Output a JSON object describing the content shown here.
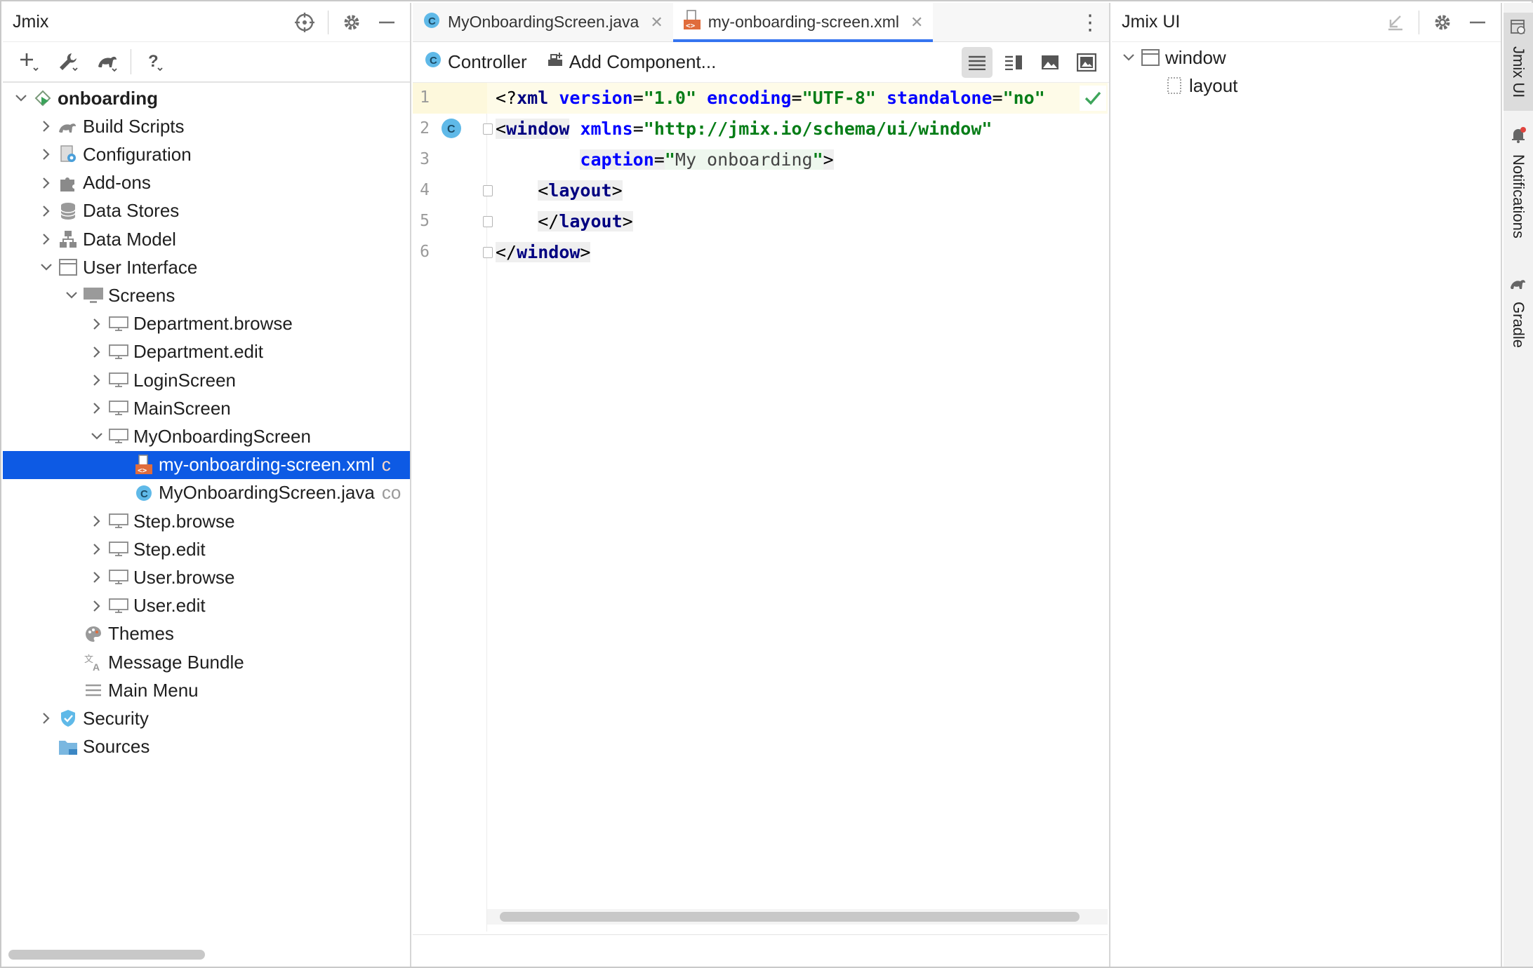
{
  "left_panel": {
    "title": "Jmix",
    "tree": [
      {
        "label": "onboarding",
        "bold": true,
        "icon": "project-icon",
        "expanded": true,
        "suffix": ""
      },
      {
        "label": "Build Scripts",
        "icon": "gradle-icon",
        "expanded": false,
        "suffix": ""
      },
      {
        "label": "Configuration",
        "icon": "configuration-icon",
        "expanded": false,
        "suffix": ""
      },
      {
        "label": "Add-ons",
        "icon": "puzzle-icon",
        "expanded": false,
        "suffix": ""
      },
      {
        "label": "Data Stores",
        "icon": "database-icon",
        "expanded": false,
        "suffix": ""
      },
      {
        "label": "Data Model",
        "icon": "data-model-icon",
        "expanded": false,
        "suffix": ""
      },
      {
        "label": "User Interface",
        "icon": "window-icon",
        "expanded": true,
        "suffix": ""
      },
      {
        "label": "Screens",
        "icon": "monitor-icon",
        "expanded": true,
        "suffix": ""
      },
      {
        "label": "Department.browse",
        "icon": "screen-icon",
        "expanded": false,
        "suffix": ""
      },
      {
        "label": "Department.edit",
        "icon": "screen-icon",
        "expanded": false,
        "suffix": ""
      },
      {
        "label": "LoginScreen",
        "icon": "screen-icon",
        "expanded": false,
        "suffix": ""
      },
      {
        "label": "MainScreen",
        "icon": "screen-icon",
        "expanded": false,
        "suffix": ""
      },
      {
        "label": "MyOnboardingScreen",
        "icon": "screen-icon",
        "expanded": true,
        "suffix": ""
      },
      {
        "label": "my-onboarding-screen.xml",
        "icon": "xml-file-icon",
        "selected": true,
        "suffix": "c"
      },
      {
        "label": "MyOnboardingScreen.java",
        "icon": "java-class-icon",
        "suffix": "co"
      },
      {
        "label": "Step.browse",
        "icon": "screen-icon",
        "expanded": false,
        "suffix": ""
      },
      {
        "label": "Step.edit",
        "icon": "screen-icon",
        "expanded": false,
        "suffix": ""
      },
      {
        "label": "User.browse",
        "icon": "screen-icon",
        "expanded": false,
        "suffix": ""
      },
      {
        "label": "User.edit",
        "icon": "screen-icon",
        "expanded": false,
        "suffix": ""
      },
      {
        "label": "Themes",
        "icon": "palette-icon",
        "suffix": ""
      },
      {
        "label": "Message Bundle",
        "icon": "translate-icon",
        "suffix": ""
      },
      {
        "label": "Main Menu",
        "icon": "menu-icon",
        "suffix": ""
      },
      {
        "label": "Security",
        "icon": "shield-icon",
        "expanded": false,
        "suffix": ""
      },
      {
        "label": "Sources",
        "icon": "folder-icon",
        "suffix": ""
      }
    ]
  },
  "editor": {
    "tabs": [
      {
        "label": "MyOnboardingScreen.java",
        "icon": "java-class-icon",
        "active": false
      },
      {
        "label": "my-onboarding-screen.xml",
        "icon": "xml-file-icon",
        "active": true
      }
    ],
    "toolbar": {
      "controller_label": "Controller",
      "add_component_label": "Add Component..."
    },
    "line_numbers": [
      "1",
      "2",
      "3",
      "4",
      "5",
      "6"
    ],
    "code": {
      "l1": {
        "open": "<?",
        "pi": "xml",
        "a1": "version",
        "v1": "\"1.0\"",
        "a2": "encoding",
        "v2": "\"UTF-8\"",
        "a3": "standalone",
        "v3": "\"no\"",
        "close": "?>"
      },
      "l2": {
        "open": "<",
        "tag": "window",
        "attr": "xmlns",
        "eq": "=",
        "val": "\"http://jmix.io/schema/ui/window\""
      },
      "l3": {
        "attr": "caption",
        "eq": "=",
        "q": "\"",
        "str": "My onboarding",
        "q2": "\"",
        "close": ">"
      },
      "l4": {
        "open": "<",
        "tag": "layout",
        "close": ">"
      },
      "l5": {
        "open": "</",
        "tag": "layout",
        "close": ">"
      },
      "l6": {
        "open": "</",
        "tag": "window",
        "close": ">"
      }
    }
  },
  "right_panel": {
    "title": "Jmix UI",
    "tree": [
      {
        "label": "window",
        "icon": "window-icon",
        "expanded": true
      },
      {
        "label": "layout",
        "icon": "layout-icon"
      }
    ]
  },
  "side_strip": {
    "items": [
      {
        "label": "Jmix UI",
        "icon": "jmix-ui-icon",
        "active": true
      },
      {
        "label": "Notifications",
        "icon": "bell-icon",
        "active": false
      },
      {
        "label": "Gradle",
        "icon": "gradle-icon",
        "active": false
      }
    ]
  },
  "colors": {
    "selection": "#0d5ae4",
    "xml_tag": "#000080",
    "xml_attr": "#0000ff",
    "xml_value": "#067d17",
    "active_tab_underline": "#3574f0"
  }
}
